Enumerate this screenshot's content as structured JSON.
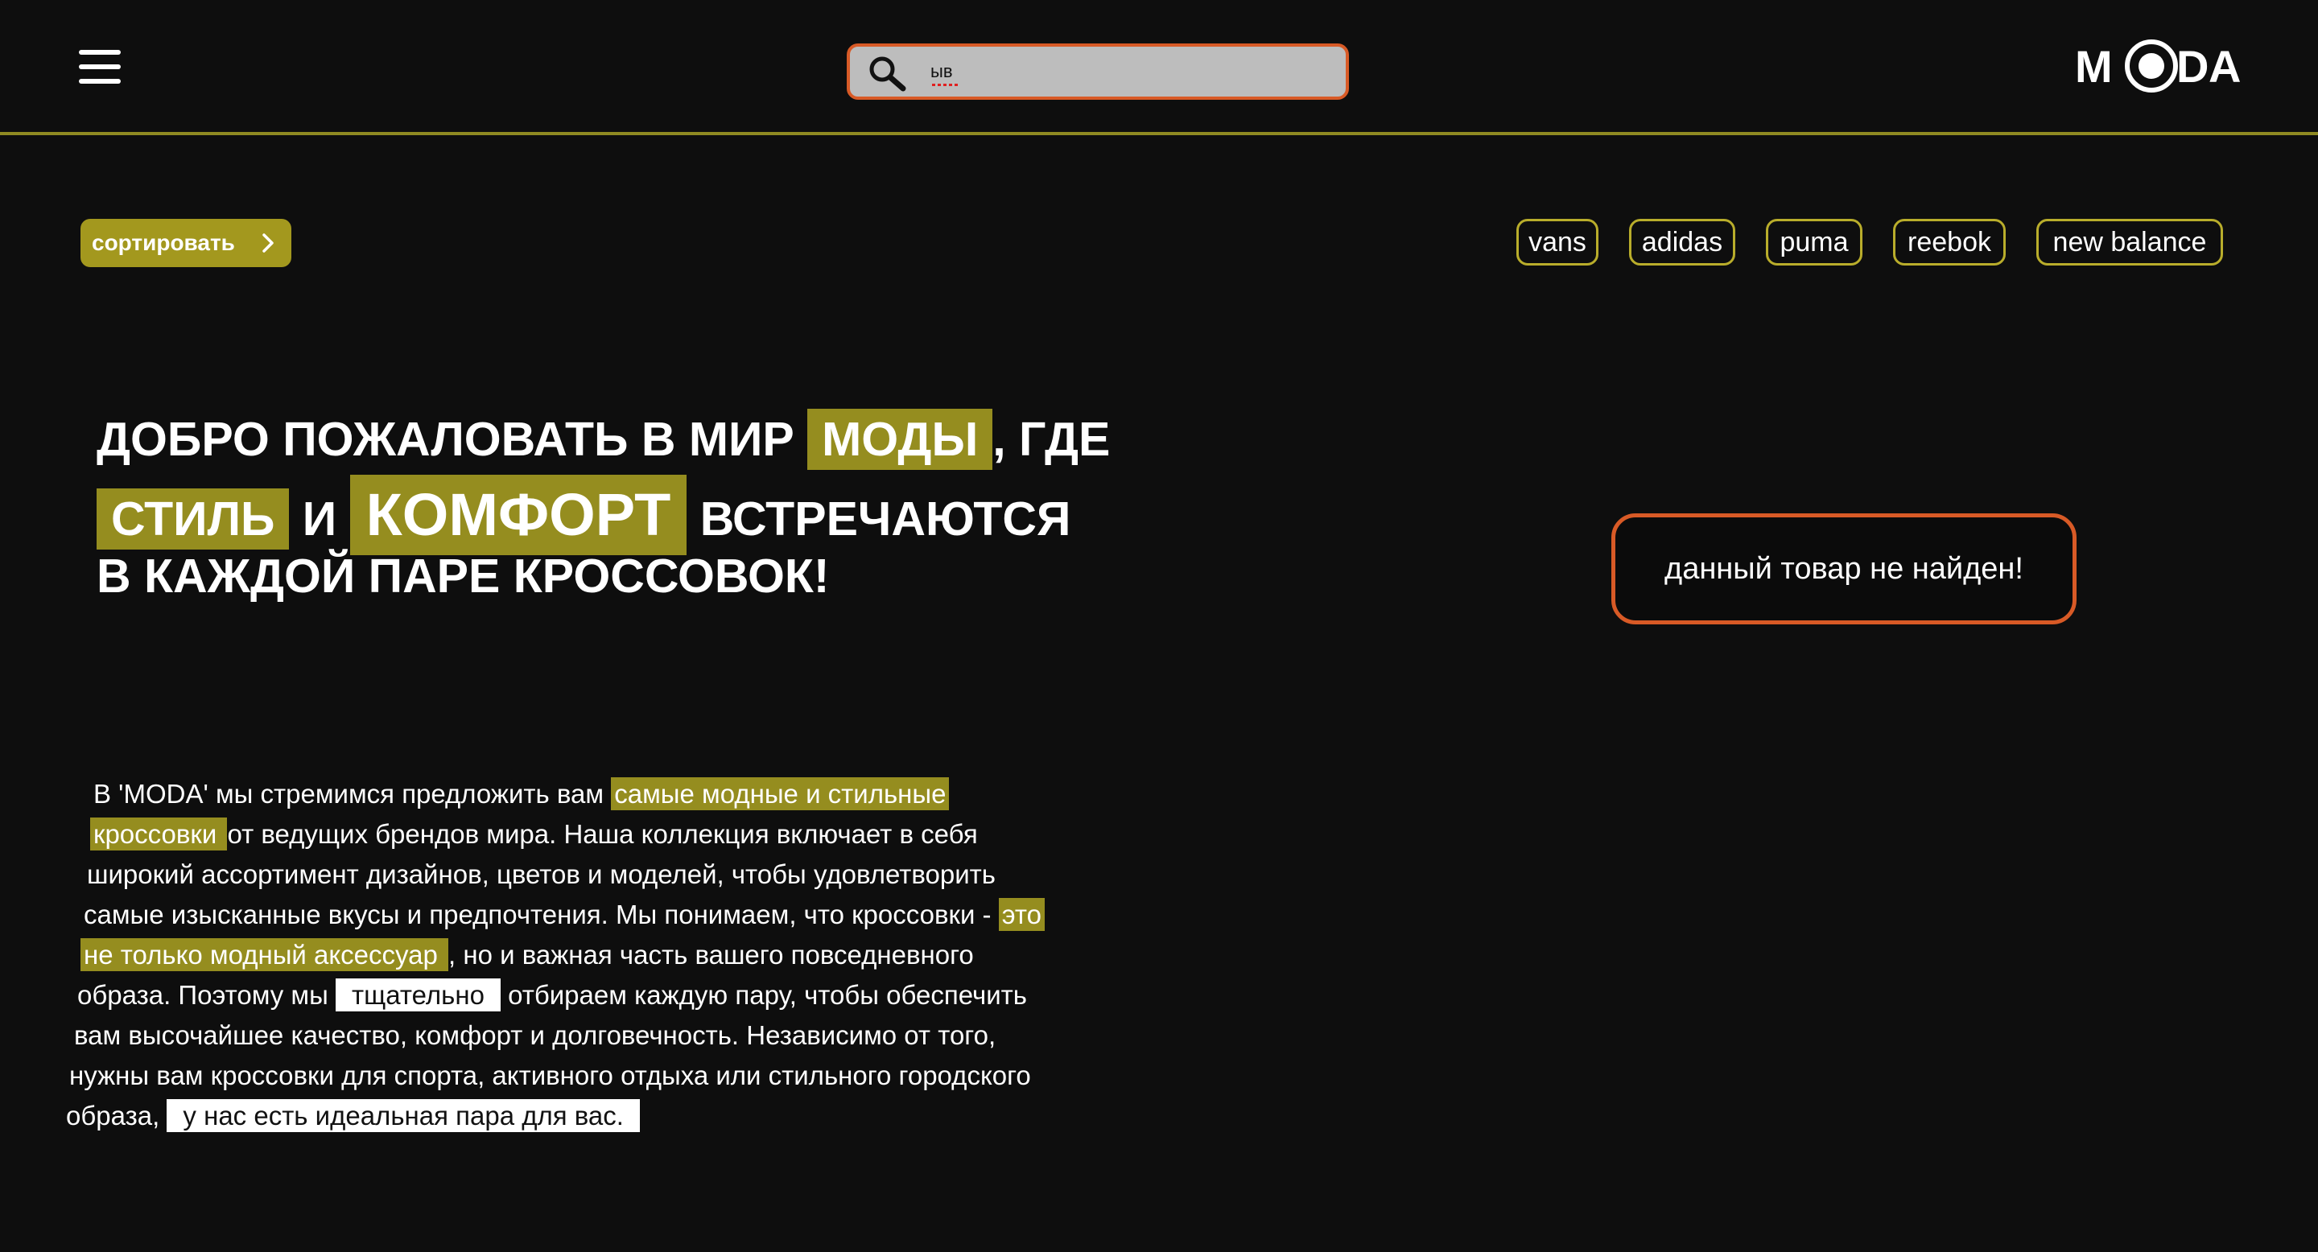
{
  "header": {
    "menu_icon": "hamburger-icon",
    "search": {
      "icon": "search-icon",
      "value": "ыв",
      "placeholder": ""
    },
    "logo": {
      "text": "MODA",
      "letters": [
        "M",
        "D",
        "A"
      ]
    },
    "accent_line_color": "#8f8a22"
  },
  "toolbar": {
    "sort_label": "сортировать",
    "brands": [
      "vans",
      "adidas",
      "puma",
      "reebok",
      "new balance"
    ]
  },
  "hero": {
    "line1_a": "Добро пожаловать в мир",
    "line1_hl": "моды",
    "line1_b": ", где",
    "line2_hl1": "стиль",
    "line2_mid": "и",
    "line2_hl2": "комфорт",
    "line2_b": "встречаются",
    "line3": "в каждой паре кроссовок!"
  },
  "notice": {
    "text": "данный товар не найден!"
  },
  "about": {
    "l1_a": "В 'MODA' мы стремимся предложить вам ",
    "l1_hl": " самые модные и стильные",
    "l2_hl": "кроссовки ",
    "l2_b": " от ведущих брендов мира. Наша коллекция включает в себя",
    "l3": "широкий ассортимент дизайнов, цветов и моделей, чтобы удовлетворить",
    "l4_a": "самые изысканные вкусы и предпочтения. Мы понимаем, что кроссовки - ",
    "l4_hl": " это",
    "l5_hl": "не только модный аксессуар ",
    "l5_b": ", но и важная часть вашего повседневного",
    "l6_a": "образа. Поэтому мы ",
    "l6_hl": "тщательно",
    "l6_b": " отбираем каждую пару, чтобы обеспечить",
    "l7": "вам высочайшее качество, комфорт и долговечность. Независимо от того,",
    "l8": "нужны вам кроссовки для спорта, активного отдыха или стильного городского",
    "l9_a": "образа, ",
    "l9_hl": "у нас есть идеальная пара для вас."
  },
  "colors": {
    "background": "#0e0e0e",
    "olive": "#958d1f",
    "orange_border": "#d85a26",
    "search_bg": "#bdbdbd"
  }
}
